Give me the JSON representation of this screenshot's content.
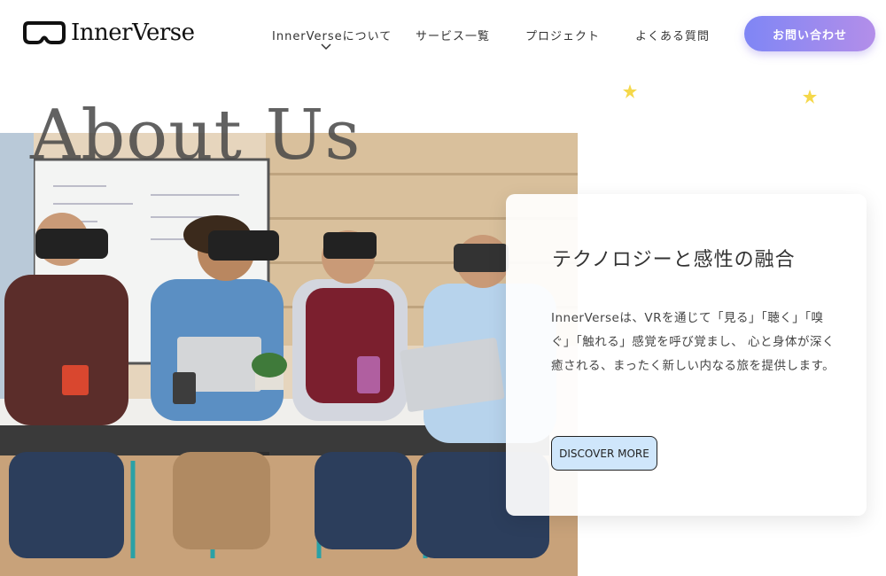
{
  "brand": {
    "name": "InnerVerse"
  },
  "nav": {
    "items": [
      {
        "label": "InnerVerseについて"
      },
      {
        "label": "サービス一覧"
      },
      {
        "label": "プロジェクト"
      },
      {
        "label": "よくある質問"
      }
    ],
    "cta": "お問い合わせ"
  },
  "hero": {
    "title": "About Us"
  },
  "card": {
    "heading": "テクノロジーと感性の融合",
    "body": "InnerVerseは、VRを通じて「見る」「聴く」「嗅ぐ」「触れる」感覚を呼び覚まし、 心と身体が深く癒される、まったく新しい内なる旅を提供します。",
    "button": "DISCOVER MORE"
  },
  "colors": {
    "cta_gradient_start": "#7f86f5",
    "cta_gradient_end": "#b38ee9",
    "discover_bg": "#cfe6fb",
    "star": "#f5d84a"
  },
  "icons": [
    "vr-headset-logo-icon",
    "chevron-down-icon",
    "star-icon"
  ]
}
